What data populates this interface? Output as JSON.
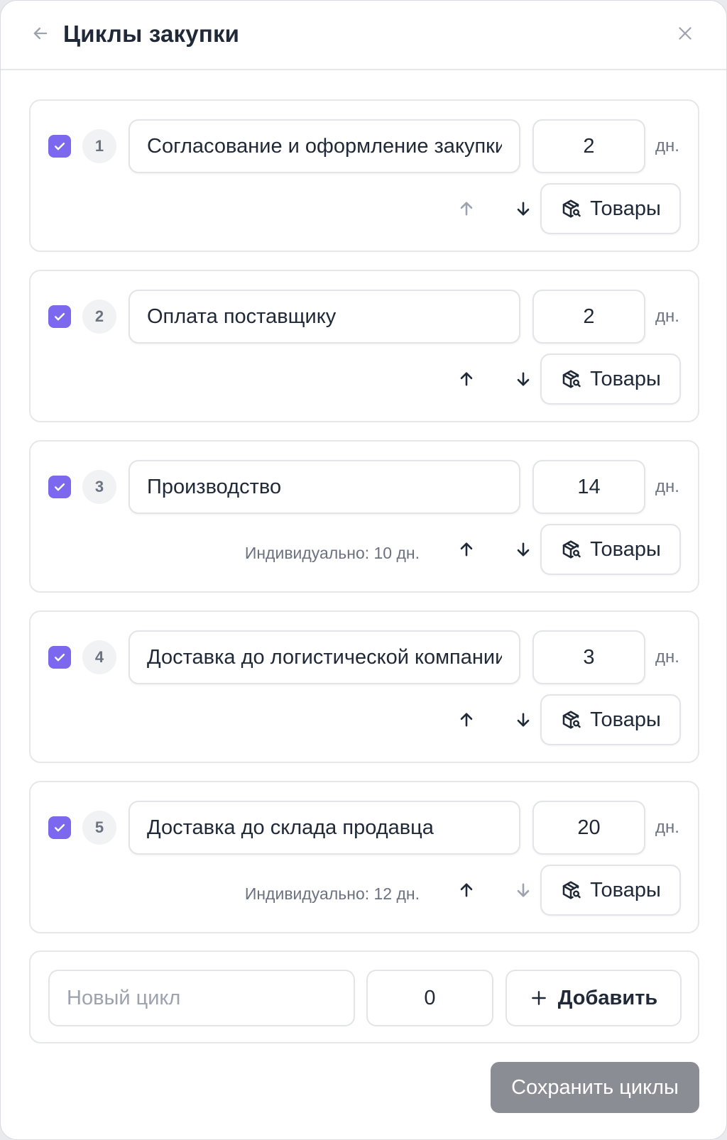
{
  "header": {
    "title": "Циклы закупки",
    "back_icon": "arrow-left-icon",
    "close_icon": "close-icon"
  },
  "colors": {
    "accent": "#7b68ee",
    "arrow_enabled": "#1f2937",
    "arrow_disabled": "#9ca3af",
    "save_button": "#8a8d93"
  },
  "cycles": [
    {
      "number": "1",
      "name": "Согласование и оформление закупки",
      "days": "2",
      "unit": "дн.",
      "individual": "",
      "checked": true,
      "up_enabled": false,
      "down_enabled": true,
      "goods_label": "Товары"
    },
    {
      "number": "2",
      "name": "Оплата поставщику",
      "days": "2",
      "unit": "дн.",
      "individual": "",
      "checked": true,
      "up_enabled": true,
      "down_enabled": true,
      "goods_label": "Товары"
    },
    {
      "number": "3",
      "name": "Производство",
      "days": "14",
      "unit": "дн.",
      "individual": "Индивидуально: 10 дн.",
      "checked": true,
      "up_enabled": true,
      "down_enabled": true,
      "goods_label": "Товары"
    },
    {
      "number": "4",
      "name": "Доставка до логистической компании",
      "days": "3",
      "unit": "дн.",
      "individual": "",
      "checked": true,
      "up_enabled": true,
      "down_enabled": true,
      "goods_label": "Товары"
    },
    {
      "number": "5",
      "name": "Доставка до склада продавца",
      "days": "20",
      "unit": "дн.",
      "individual": "Индивидуально: 12 дн.",
      "checked": true,
      "up_enabled": true,
      "down_enabled": false,
      "goods_label": "Товары"
    }
  ],
  "new_cycle": {
    "name_value": "",
    "name_placeholder": "Новый цикл",
    "days_value": "0",
    "add_label": "Добавить",
    "add_icon": "plus-icon"
  },
  "footer": {
    "save_label": "Сохранить циклы"
  }
}
